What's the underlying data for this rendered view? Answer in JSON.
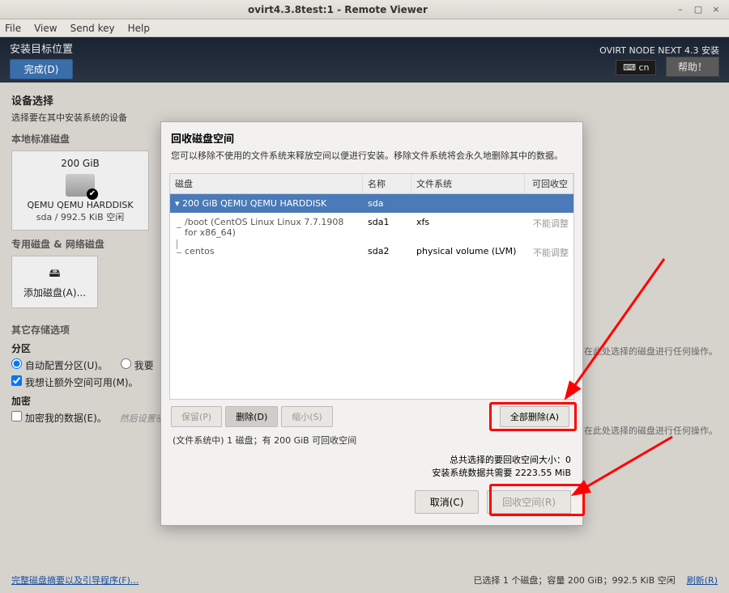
{
  "window": {
    "title": "ovirt4.3.8test:1 - Remote Viewer",
    "menu": {
      "file": "File",
      "view": "View",
      "sendkey": "Send key",
      "help": "Help"
    }
  },
  "header": {
    "page_title": "安装目标位置",
    "done": "完成(D)",
    "product": "OVIRT NODE NEXT 4.3 安装",
    "keyboard": "cn",
    "help": "帮助！"
  },
  "main": {
    "device_select": "设备选择",
    "device_hint": "选择要在其中安装系统的设备",
    "local_disks": "本地标准磁盘",
    "disk": {
      "size": "200 GiB",
      "model": "QEMU QEMU HARDDISK",
      "free": "sda  /  992.5 KiB 空闲"
    },
    "special_disks": "专用磁盘 & 网络磁盘",
    "add_disk": "添加磁盘(A)...",
    "other_storage": "其它存储选项",
    "partition": "分区",
    "auto_part": "自动配置分区(U)。",
    "manual_part": "我要",
    "reclaim_cb": "我想让额外空间可用(M)。",
    "encryption": "加密",
    "encrypt_cb": "加密我的数据(E)。",
    "encrypt_hint": "然后设置密码",
    "no_op_hint": "在此处选择的磁盘进行任何操作。"
  },
  "footer": {
    "summary_link": "完整磁盘摘要以及引导程序(F)...",
    "status": "已选择 1 个磁盘；容量 200 GiB；992.5 KiB 空闲",
    "refresh": "刷新(R)"
  },
  "dialog": {
    "title": "回收磁盘空间",
    "desc": "您可以移除不使用的文件系统来释放空间以便进行安装。移除文件系统将会永久地删除其中的数据。",
    "cols": {
      "disk": "磁盘",
      "name": "名称",
      "fs": "文件系统",
      "reclaim": "可回收空"
    },
    "rows": [
      {
        "disk": "200 GiB QEMU QEMU HARDDISK",
        "name": "sda",
        "fs": "",
        "rec": "",
        "selected": true
      },
      {
        "disk": "/boot (CentOS Linux Linux 7.7.1908 for x86_64)",
        "name": "sda1",
        "fs": "xfs",
        "rec": "不能调整"
      },
      {
        "disk": "centos",
        "name": "sda2",
        "fs": "physical volume (LVM)",
        "rec": "不能调整"
      }
    ],
    "actions": {
      "preserve": "保留(P)",
      "delete": "删除(D)",
      "shrink": "缩小(S)",
      "delete_all": "全部删除(A)"
    },
    "summary": "(文件系统中) 1 磁盘；有 200 GiB 可回收空间",
    "total_selected": "总共选择的要回收空间大小：0",
    "required": "安装系统数据共需要 2223.55 MiB",
    "cancel": "取消(C)",
    "reclaim": "回收空间(R)"
  }
}
